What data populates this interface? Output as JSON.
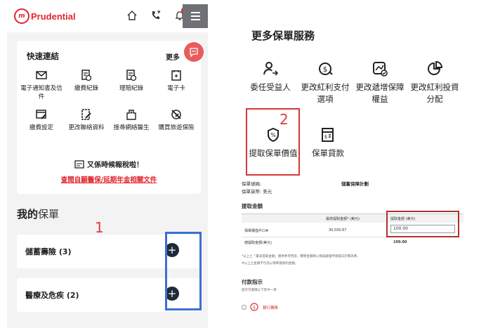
{
  "left": {
    "logo": {
      "mark": "m",
      "name": "Prudential"
    },
    "notification_count": "10",
    "quick_links": {
      "title": "快速連結",
      "more": "更多",
      "row1": [
        {
          "label": "電子通知書及信件",
          "icon": "envelope-icon"
        },
        {
          "label": "繳費紀錄",
          "icon": "payment-record-icon"
        },
        {
          "label": "理賠紀錄",
          "icon": "claim-record-icon"
        },
        {
          "label": "電子卡",
          "icon": "ecard-icon"
        }
      ],
      "row2": [
        {
          "label": "繳費設定",
          "icon": "payment-setting-icon"
        },
        {
          "label": "更改聯絡資料",
          "icon": "edit-contact-icon"
        },
        {
          "label": "搜尋網絡醫生",
          "icon": "hospital-icon"
        },
        {
          "label": "購買旅遊保險",
          "icon": "travel-insurance-icon"
        }
      ],
      "tax_text": "又係時候報稅啦！",
      "tax_link": "查閱自願醫保/延期年金相關文件"
    },
    "policy_heading_bold": "我的",
    "policy_heading_rest": "保單",
    "annotation": "1",
    "policies": [
      {
        "label": "儲蓄壽險 (3)"
      },
      {
        "label": "醫療及危疾 (2)"
      }
    ]
  },
  "right": {
    "title": "更多保單服務",
    "services_row1": [
      {
        "label": "委任受益人",
        "icon": "beneficiary-icon"
      },
      {
        "label": "更改紅利支付選項",
        "icon": "dividend-option-icon"
      },
      {
        "label": "更改遞增保障權益",
        "icon": "increase-coverage-icon"
      },
      {
        "label": "更改紅利投資分配",
        "icon": "dividend-allocation-icon"
      }
    ],
    "services_row2": [
      {
        "label": "提取保單價值",
        "icon": "withdraw-value-icon"
      },
      {
        "label": "保單貸款",
        "icon": "policy-loan-icon"
      }
    ],
    "annotation": "2",
    "doc": {
      "policy_no_label": "保單號碼:",
      "plan_name": "儲蓄保障計劃",
      "currency_label": "保單貨幣: 美元",
      "section_withdraw": "提取金額",
      "col_max": "最高提取金額* (美元)",
      "col_amount": "提取金額 (美元)",
      "row_label": "保單價值戶口#",
      "row_max": "30,030.67",
      "input_value": "100.00",
      "total_label": "總提取金額(美元)",
      "total_value": "100.00",
      "footnote1": "*以上之「最高提取金額」僅供參考用途，實際金額將以保誠處理申請當日計算為準。",
      "footnote2": "#以上之金額不包括以保單貸款的金額。",
      "section_payment": "付款指示",
      "payment_sub": "提示可選擇以下其中一項",
      "payment_option": "銀行轉賬"
    }
  }
}
